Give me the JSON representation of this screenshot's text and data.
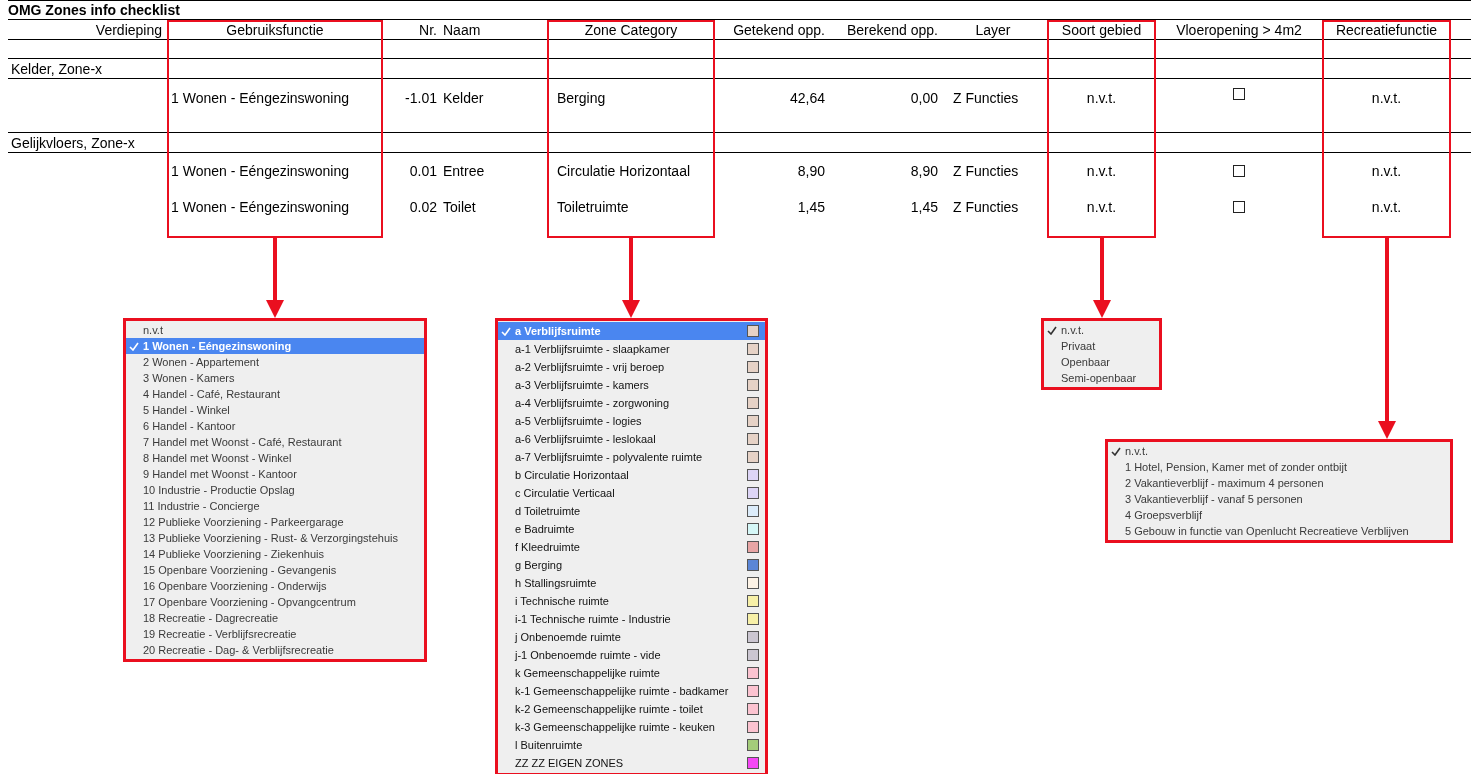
{
  "title": "OMG Zones info checklist",
  "columns": [
    {
      "label": "Verdieping",
      "highlighted": false
    },
    {
      "label": "Gebruiksfunctie",
      "highlighted": true
    },
    {
      "label": "Nr.",
      "highlighted": false
    },
    {
      "label": "Naam",
      "highlighted": false
    },
    {
      "label": "Zone Category",
      "highlighted": true
    },
    {
      "label": "Getekend opp.",
      "highlighted": false
    },
    {
      "label": "Berekend opp.",
      "highlighted": false
    },
    {
      "label": "Layer",
      "highlighted": false
    },
    {
      "label": "Soort gebied",
      "highlighted": true
    },
    {
      "label": "Vloeropening > 4m2",
      "highlighted": false
    },
    {
      "label": "Recreatiefunctie",
      "highlighted": true
    }
  ],
  "groups": [
    {
      "label": "Kelder, Zone-x",
      "rows": [
        {
          "gebruiksfunctie": "1 Wonen - Eéngezinswoning",
          "nr": "-1.01",
          "naam": "Kelder",
          "zone_category": "Berging",
          "getekend_opp": "42,64",
          "berekend_opp": "0,00",
          "layer": "Z Functies",
          "soort_gebied": "n.v.t.",
          "vloeropening_checked": false,
          "recreatiefunctie": "n.v.t."
        }
      ]
    },
    {
      "label": "Gelijkvloers, Zone-x",
      "rows": [
        {
          "gebruiksfunctie": "1 Wonen - Eéngezinswoning",
          "nr": "0.01",
          "naam": "Entree",
          "zone_category": "Circulatie Horizontaal",
          "getekend_opp": "8,90",
          "berekend_opp": "8,90",
          "layer": "Z Functies",
          "soort_gebied": "n.v.t.",
          "vloeropening_checked": false,
          "recreatiefunctie": "n.v.t."
        },
        {
          "gebruiksfunctie": "1 Wonen - Eéngezinswoning",
          "nr": "0.02",
          "naam": "Toilet",
          "zone_category": "Toiletruimte",
          "getekend_opp": "1,45",
          "berekend_opp": "1,45",
          "layer": "Z Functies",
          "soort_gebied": "n.v.t.",
          "vloeropening_checked": false,
          "recreatiefunctie": "n.v.t."
        }
      ]
    }
  ],
  "dropdowns": [
    {
      "kind": "highlight",
      "items": [
        {
          "label": "n.v.t",
          "selected": false
        },
        {
          "label": "1 Wonen - Eéngezinswoning",
          "selected": true
        },
        {
          "label": "2 Wonen - Appartement",
          "selected": false
        },
        {
          "label": "3 Wonen - Kamers",
          "selected": false
        },
        {
          "label": "4 Handel - Café, Restaurant",
          "selected": false
        },
        {
          "label": "5 Handel - Winkel",
          "selected": false
        },
        {
          "label": "6 Handel - Kantoor",
          "selected": false
        },
        {
          "label": "7 Handel met Woonst - Café, Restaurant",
          "selected": false
        },
        {
          "label": "8 Handel met Woonst - Winkel",
          "selected": false
        },
        {
          "label": "9 Handel met Woonst - Kantoor",
          "selected": false
        },
        {
          "label": "10 Industrie - Productie Opslag",
          "selected": false
        },
        {
          "label": "11 Industrie - Concierge",
          "selected": false
        },
        {
          "label": "12 Publieke Voorziening - Parkeergarage",
          "selected": false
        },
        {
          "label": "13 Publieke Voorziening - Rust- & Verzorgingstehuis",
          "selected": false
        },
        {
          "label": "14 Publieke Voorziening - Ziekenhuis",
          "selected": false
        },
        {
          "label": "15 Openbare Voorziening - Gevangenis",
          "selected": false
        },
        {
          "label": "16 Openbare Voorziening - Onderwijs",
          "selected": false
        },
        {
          "label": "17 Openbare Voorziening - Opvangcentrum",
          "selected": false
        },
        {
          "label": "18 Recreatie - Dagrecreatie",
          "selected": false
        },
        {
          "label": "19 Recreatie - Verblijfsrecreatie",
          "selected": false
        },
        {
          "label": "20 Recreatie - Dag- & Verblijfsrecreatie",
          "selected": false
        }
      ]
    },
    {
      "kind": "highlight",
      "items": [
        {
          "label": "a Verblijfsruimte",
          "selected": true,
          "color": "#e6d2c6"
        },
        {
          "label": "a-1 Verblijfsruimte - slaapkamer",
          "selected": false,
          "color": "#e6d2c6"
        },
        {
          "label": "a-2 Verblijfsruimte - vrij beroep",
          "selected": false,
          "color": "#e6d2c6"
        },
        {
          "label": "a-3 Verblijfsruimte - kamers",
          "selected": false,
          "color": "#e6d2c6"
        },
        {
          "label": "a-4 Verblijfsruimte - zorgwoning",
          "selected": false,
          "color": "#e6d2c6"
        },
        {
          "label": "a-5 Verblijfsruimte - logies",
          "selected": false,
          "color": "#e6d2c6"
        },
        {
          "label": "a-6 Verblijfsruimte - leslokaal",
          "selected": false,
          "color": "#e6d2c6"
        },
        {
          "label": "a-7 Verblijfsruimte - polyvalente ruimte",
          "selected": false,
          "color": "#e6d2c6"
        },
        {
          "label": "b Circulatie Horizontaal",
          "selected": false,
          "color": "#ddd5f6"
        },
        {
          "label": "c Circulatie Verticaal",
          "selected": false,
          "color": "#ddd5f6"
        },
        {
          "label": "d Toiletruimte",
          "selected": false,
          "color": "#dcecfa"
        },
        {
          "label": "e Badruimte",
          "selected": false,
          "color": "#d5f7f7"
        },
        {
          "label": "f Kleedruimte",
          "selected": false,
          "color": "#e8a5a5"
        },
        {
          "label": "g Berging",
          "selected": false,
          "color": "#5b86d6"
        },
        {
          "label": "h Stallingsruimte",
          "selected": false,
          "color": "#fdf3e6"
        },
        {
          "label": "i Technische ruimte",
          "selected": false,
          "color": "#f7f0a8"
        },
        {
          "label": "i-1 Technische ruimte - Industrie",
          "selected": false,
          "color": "#f7f0a8"
        },
        {
          "label": "j Onbenoemde ruimte",
          "selected": false,
          "color": "#cbc6d1"
        },
        {
          "label": "j-1 Onbenoemde ruimte - vide",
          "selected": false,
          "color": "#cbc6d1"
        },
        {
          "label": "k Gemeenschappelijke ruimte",
          "selected": false,
          "color": "#fbc3d0"
        },
        {
          "label": "k-1 Gemeenschappelijke ruimte - badkamer",
          "selected": false,
          "color": "#fbc3d0"
        },
        {
          "label": "k-2 Gemeenschappelijke ruimte - toilet",
          "selected": false,
          "color": "#fbc3d0"
        },
        {
          "label": "k-3 Gemeenschappelijke ruimte - keuken",
          "selected": false,
          "color": "#fbc3d0"
        },
        {
          "label": "l Buitenruimte",
          "selected": false,
          "color": "#a4cc7a"
        },
        {
          "label": "ZZ ZZ EIGEN ZONES",
          "selected": false,
          "color": "#f447f4"
        }
      ]
    },
    {
      "kind": "plain",
      "items": [
        {
          "label": "n.v.t.",
          "selected": true
        },
        {
          "label": "Privaat",
          "selected": false
        },
        {
          "label": "Openbaar",
          "selected": false
        },
        {
          "label": "Semi-openbaar",
          "selected": false
        }
      ]
    },
    {
      "kind": "plain",
      "items": [
        {
          "label": "n.v.t.",
          "selected": true
        },
        {
          "label": "1 Hotel, Pension, Kamer met of zonder ontbijt",
          "selected": false
        },
        {
          "label": "2 Vakantieverblijf - maximum 4 personen",
          "selected": false
        },
        {
          "label": "3 Vakantieverblijf - vanaf 5 personen",
          "selected": false
        },
        {
          "label": "4 Groepsverblijf",
          "selected": false
        },
        {
          "label": "5 Gebouw in functie van Openlucht Recreatieve Verblijven",
          "selected": false
        }
      ]
    }
  ]
}
